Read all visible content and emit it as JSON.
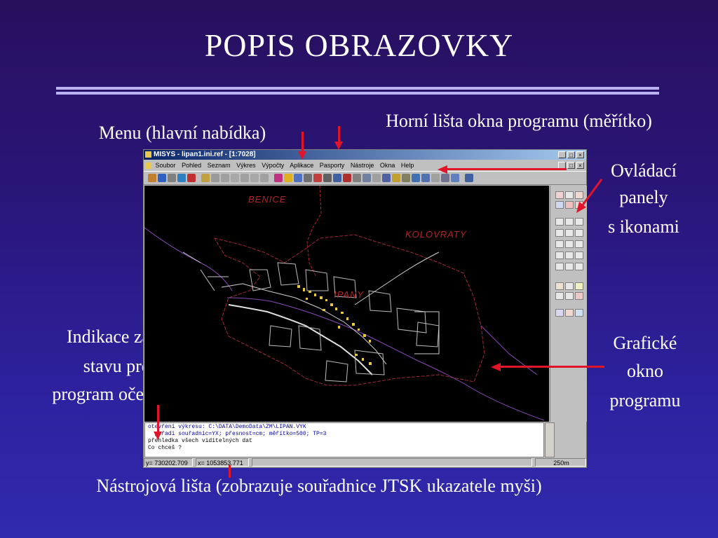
{
  "slide": {
    "title": "POPIS OBRAZOVKY",
    "labels": {
      "menu": "Menu (hlavní nabídka)",
      "top_bar": "Horní lišta okna programu (měřítko)",
      "control_panels_1": "Ovládací",
      "control_panels_2": "panely",
      "control_panels_3": "s ikonami",
      "status_indication_1": "Indikace základního",
      "status_indication_2": "stavu programu",
      "status_indication_3": "program očekává příkaz",
      "graphic_window_1": "Grafické",
      "graphic_window_2": "okno",
      "graphic_window_3": "programu",
      "toolbar": "Nástrojová lišta (zobrazuje souřadnice JTSK ukazatele myši)"
    },
    "arrow_color": "#e0152a"
  },
  "app": {
    "window_title": "MISYS - lipan1.ini.ref - [1:7028]",
    "menu": [
      "Soubor",
      "Pohled",
      "Seznam",
      "Výkres",
      "Výpočty",
      "Aplikace",
      "Pasporty",
      "Nástroje",
      "Okna",
      "Help"
    ],
    "map_labels": {
      "a": "BENICE",
      "b": "KOLOVRATY",
      "c": "IPANY"
    },
    "command_lines": [
      "otevření výkresu: C:\\DATA\\DemoData\\ZM\\LIPAN.VYK",
      "  pořadí souřadnic=YX; přesnost=cm; měřítko=500; TP=3",
      "přehledka všech viditelných dat",
      "Co chceš ?"
    ],
    "status": {
      "y": "y= 730202.709",
      "x": "x= 1053853.771",
      "scale": "250m"
    }
  }
}
